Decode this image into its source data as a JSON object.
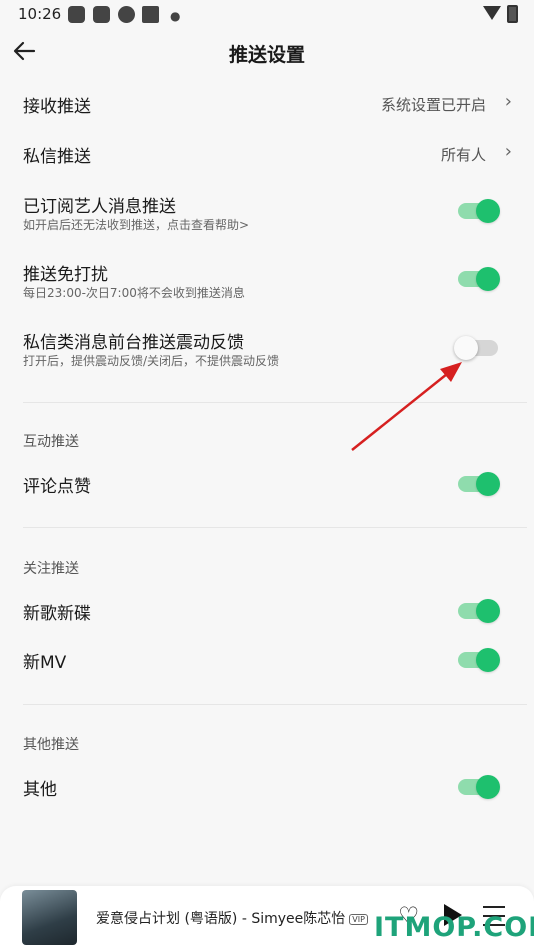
{
  "status_bar": {
    "time": "10:26",
    "icons": [
      "app-icon",
      "app-icon",
      "app-icon",
      "app-icon"
    ]
  },
  "header": {
    "title": "推送设置",
    "back_icon": "arrow-left-icon"
  },
  "rows": {
    "receive_push": {
      "label": "接收推送",
      "value": "系统设置已开启"
    },
    "dm_push": {
      "label": "私信推送",
      "value": "所有人"
    },
    "artist_push": {
      "label": "已订阅艺人消息推送",
      "sub": "如开启后还无法收到推送，点击查看帮助>",
      "on": true
    },
    "dnd": {
      "label": "推送免打扰",
      "sub": "每日23:00-次日7:00将不会收到推送消息",
      "on": true
    },
    "vibration": {
      "label": "私信类消息前台推送震动反馈",
      "sub": "打开后，提供震动反馈/关闭后，不提供震动反馈",
      "on": false
    }
  },
  "sections": {
    "interaction": {
      "title": "互动推送",
      "items": {
        "comment_like": {
          "label": "评论点赞",
          "on": true
        }
      }
    },
    "follow": {
      "title": "关注推送",
      "items": {
        "new_songs": {
          "label": "新歌新碟",
          "on": true
        },
        "new_mv": {
          "label": "新MV",
          "on": true
        }
      }
    },
    "other": {
      "title": "其他推送",
      "items": {
        "other": {
          "label": "其他",
          "on": true
        }
      }
    }
  },
  "player": {
    "song": "爱意侵占计划 (粤语版) - Simyee陈芯怡",
    "vip_badge": "VIP",
    "icons": [
      "heart-icon",
      "play-icon",
      "playlist-icon"
    ]
  },
  "watermark": "ITMOP.COM",
  "colors": {
    "toggle_on": "#1ec06e",
    "toggle_on_track": "#8fdcad",
    "annotation_arrow": "#d62020"
  }
}
